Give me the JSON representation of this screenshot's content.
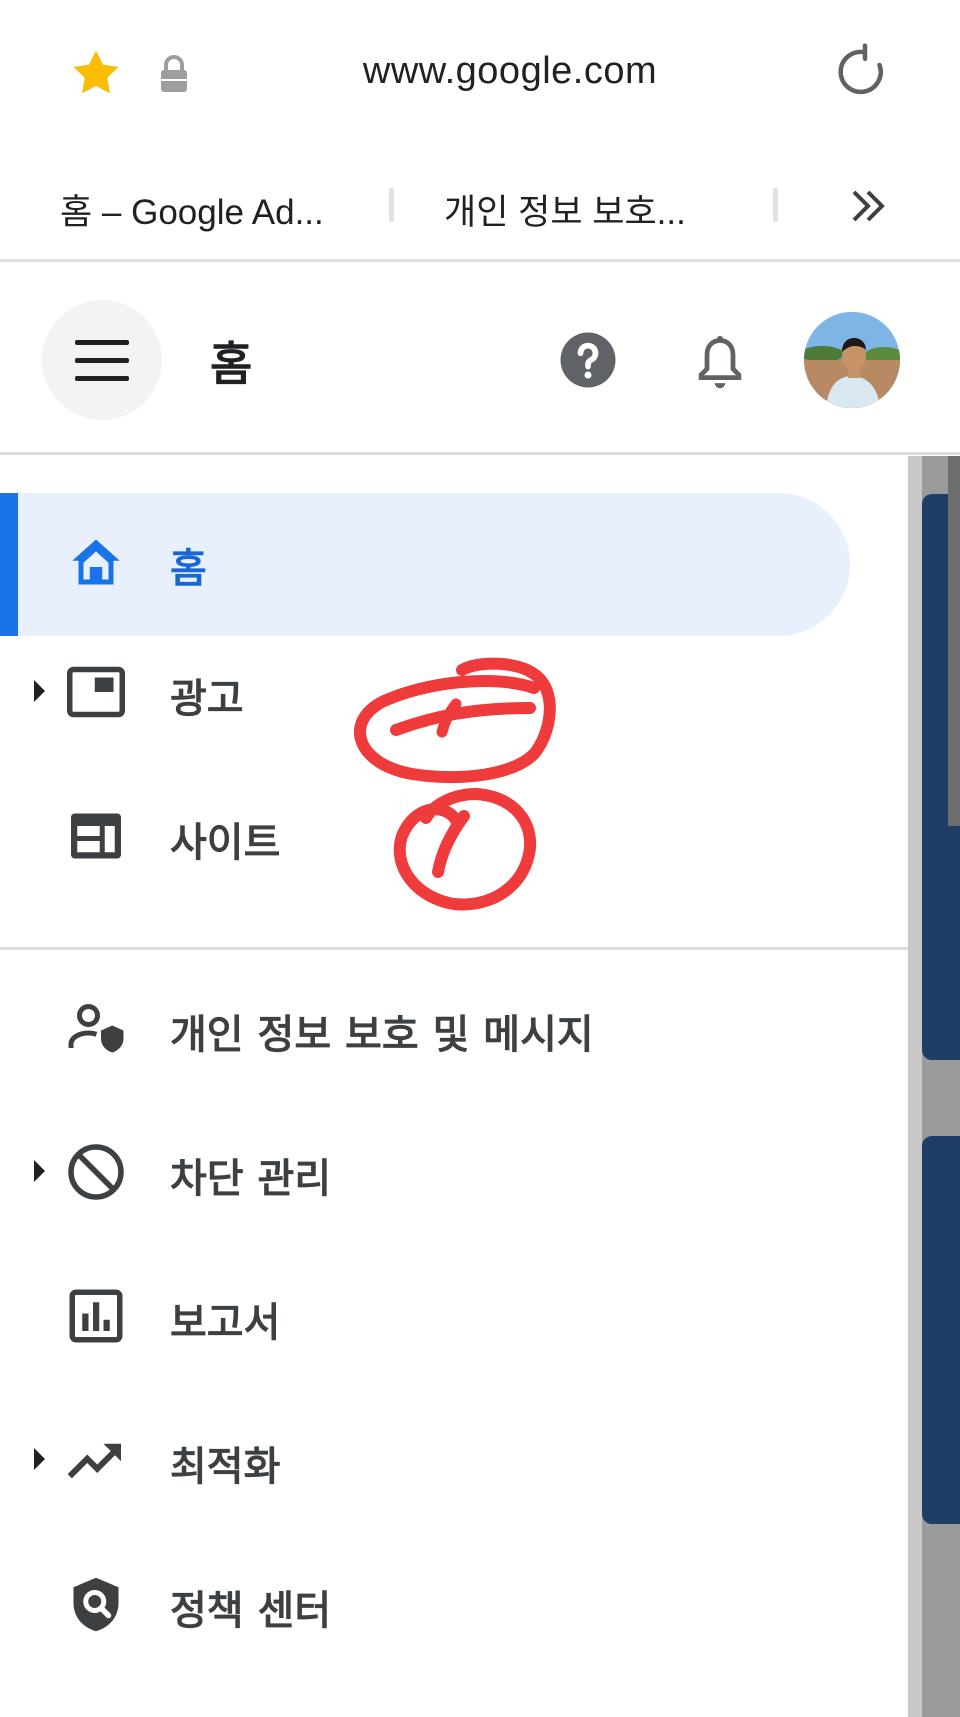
{
  "browser": {
    "url": "www.google.com",
    "tabs": [
      {
        "label": "홈 – Google Ad..."
      },
      {
        "label": "개인 정보 보호..."
      }
    ],
    "icons": {
      "favorite": "star-icon",
      "secure": "lock-icon",
      "reload": "reload-icon",
      "more_tabs": "chevron-double-right-icon"
    },
    "colors": {
      "star": "#fbbc04"
    }
  },
  "header": {
    "title": "홈",
    "icons": [
      "menu-icon",
      "help-icon",
      "bell-icon",
      "avatar"
    ]
  },
  "nav": {
    "items": [
      {
        "label": "홈",
        "icon": "home-icon",
        "active": true,
        "expandable": false
      },
      {
        "label": "광고",
        "icon": "ads-icon",
        "active": false,
        "expandable": true
      },
      {
        "label": "사이트",
        "icon": "sites-icon",
        "active": false,
        "expandable": false
      },
      {
        "label": "개인 정보 보호 및 메시지",
        "icon": "privacy-icon",
        "active": false,
        "expandable": false
      },
      {
        "label": "차단 관리",
        "icon": "block-icon",
        "active": false,
        "expandable": true
      },
      {
        "label": "보고서",
        "icon": "report-icon",
        "active": false,
        "expandable": false
      },
      {
        "label": "최적화",
        "icon": "trending-icon",
        "active": false,
        "expandable": true
      },
      {
        "label": "정책 센터",
        "icon": "policy-icon",
        "active": false,
        "expandable": false
      }
    ]
  },
  "annotation": {
    "icon": "handwritten-scribble",
    "color": "#ef3b3b"
  },
  "theme": {
    "accent": "#1a73e8",
    "active_bg": "#e8f0fe",
    "text": "#3c4043"
  }
}
